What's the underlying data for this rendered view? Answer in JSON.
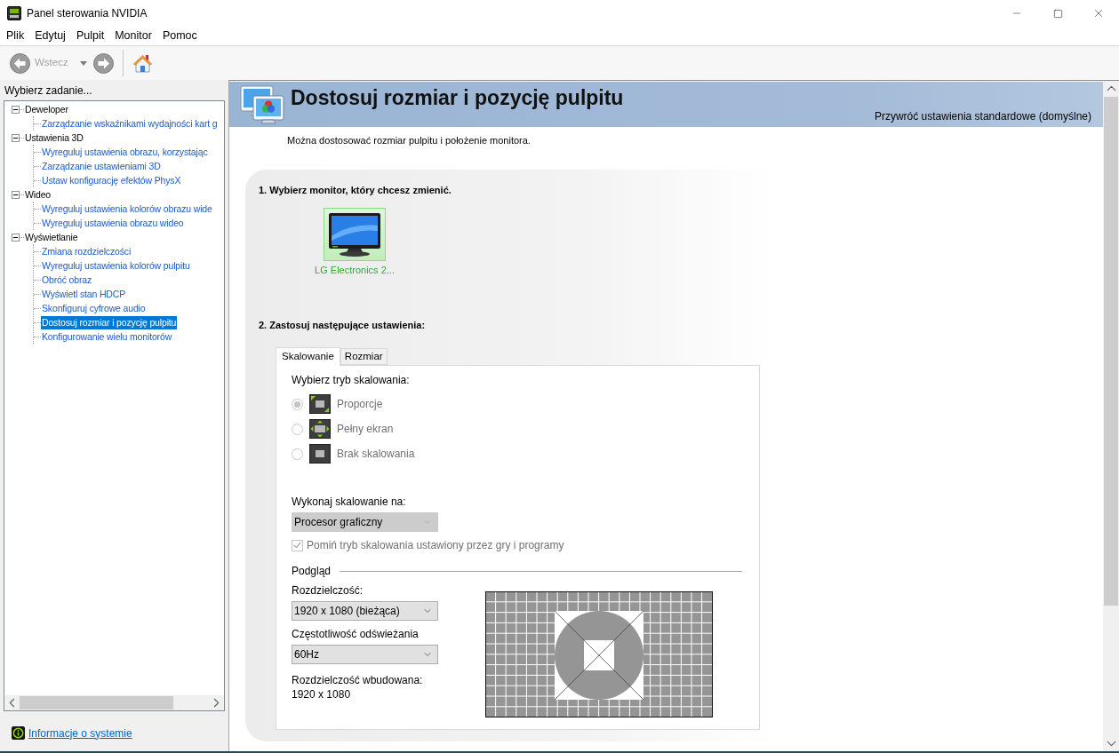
{
  "window": {
    "title": "Panel sterowania NVIDIA"
  },
  "menu": [
    "Plik",
    "Edytuj",
    "Pulpit",
    "Monitor",
    "Pomoc"
  ],
  "toolbar": {
    "back": {
      "label": "Wstecz",
      "disabled": true
    },
    "forward": {
      "disabled": true
    }
  },
  "sidebar": {
    "heading": "Wybierz zadanie...",
    "tree": [
      {
        "label": "Deweloper",
        "expanded": true,
        "selected": false,
        "children": [
          {
            "label": "Zarządzanie wskaźnikami wydajności kart g",
            "selected": false
          }
        ]
      },
      {
        "label": "Ustawienia 3D",
        "expanded": true,
        "selected": false,
        "children": [
          {
            "label": "Wyreguluj ustawienia obrazu, korzystając",
            "selected": false
          },
          {
            "label": "Zarządzanie ustawieniami 3D",
            "selected": false
          },
          {
            "label": "Ustaw konfigurację efektów PhysX",
            "selected": false
          }
        ]
      },
      {
        "label": "Wideo",
        "expanded": true,
        "selected": false,
        "children": [
          {
            "label": "Wyreguluj ustawienia kolorów obrazu wide",
            "selected": false
          },
          {
            "label": "Wyreguluj ustawienia obrazu wideo",
            "selected": false
          }
        ]
      },
      {
        "label": "Wyświetlanie",
        "expanded": true,
        "selected": false,
        "children": [
          {
            "label": "Zmiana rozdzielczości",
            "selected": false
          },
          {
            "label": "Wyreguluj ustawienia kolorów pulpitu",
            "selected": false
          },
          {
            "label": "Obróć obraz",
            "selected": false
          },
          {
            "label": "Wyświetl stan HDCP",
            "selected": false
          },
          {
            "label": "Skonfiguruj cyfrowe audio",
            "selected": false
          },
          {
            "label": "Dostosuj rozmiar i pozycję pulpitu",
            "selected": true
          },
          {
            "label": "Konfigurowanie wielu monitorów",
            "selected": false
          }
        ]
      }
    ],
    "footer_link": "Informacje o systemie"
  },
  "page": {
    "title": "Dostosuj rozmiar i pozycję pulpitu",
    "restore_link": "Przywróć ustawienia standardowe (domyślne)",
    "description": "Można dostosować rozmiar pulpitu i położenie monitora.",
    "step1": {
      "heading": "1. Wybierz monitor, który chcesz zmienić.",
      "monitors": [
        {
          "name": "LG Electronics 2...",
          "selected": true
        }
      ]
    },
    "step2": {
      "heading": "2. Zastosuj następujące ustawienia:",
      "tabs": [
        {
          "label": "Skalowanie",
          "selected": true
        },
        {
          "label": "Rozmiar",
          "selected": false
        }
      ],
      "scaling_label": "Wybierz tryb skalowania:",
      "scaling_modes": [
        {
          "kind": "aspect",
          "label": "Proporcje",
          "selected": true,
          "disabled": true
        },
        {
          "kind": "full",
          "label": "Pełny ekran",
          "selected": false,
          "disabled": true
        },
        {
          "kind": "none",
          "label": "Brak skalowania",
          "selected": false,
          "disabled": true
        }
      ],
      "perform_label": "Wykonaj skalowanie na:",
      "perform_select": {
        "value": "Procesor graficzny",
        "disabled": true
      },
      "override": {
        "label": "Pomiń tryb skalowania ustawiony przez gry i programy",
        "checked": true,
        "disabled": true
      },
      "preview": {
        "heading": "Podgląd",
        "resolution_label": "Rozdzielczość:",
        "resolution_select": {
          "value": "1920 x 1080 (bieżąca)"
        },
        "refresh_label": "Częstotliwość odświeżania",
        "refresh_select": {
          "value": "60Hz"
        },
        "native_label": "Rozdzielczość wbudowana:",
        "native_value": "1920 x 1080"
      }
    }
  }
}
